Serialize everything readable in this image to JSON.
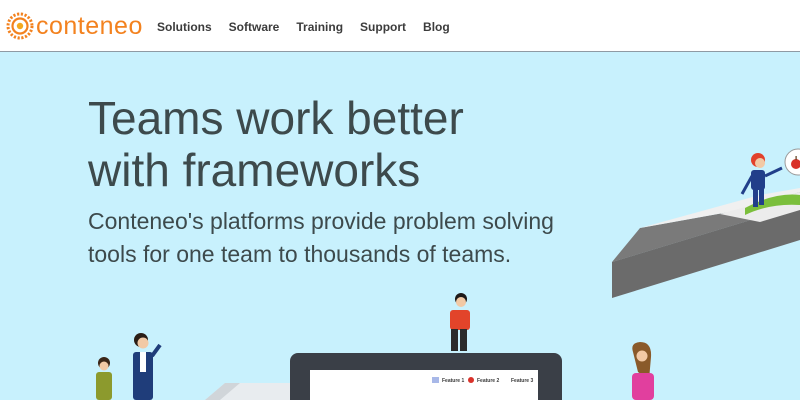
{
  "brand": {
    "name": "conteneo",
    "color": "#f3821f"
  },
  "nav": {
    "items": [
      {
        "label": "Solutions"
      },
      {
        "label": "Software"
      },
      {
        "label": "Training"
      },
      {
        "label": "Support"
      },
      {
        "label": "Blog"
      }
    ]
  },
  "hero": {
    "title": "Teams work better with frameworks",
    "subtitle": "Conteneo's platforms provide problem solving tools for one team to thousands of teams.",
    "background": "#c8f1fd"
  },
  "illustration": {
    "screen_legend": [
      {
        "label": "Feature 1",
        "icon": "square-icon"
      },
      {
        "label": "Feature 2",
        "icon": "apple-icon"
      },
      {
        "label": "Feature 3",
        "icon": "none"
      }
    ],
    "speech_bubble_icon": "apple-icon"
  }
}
